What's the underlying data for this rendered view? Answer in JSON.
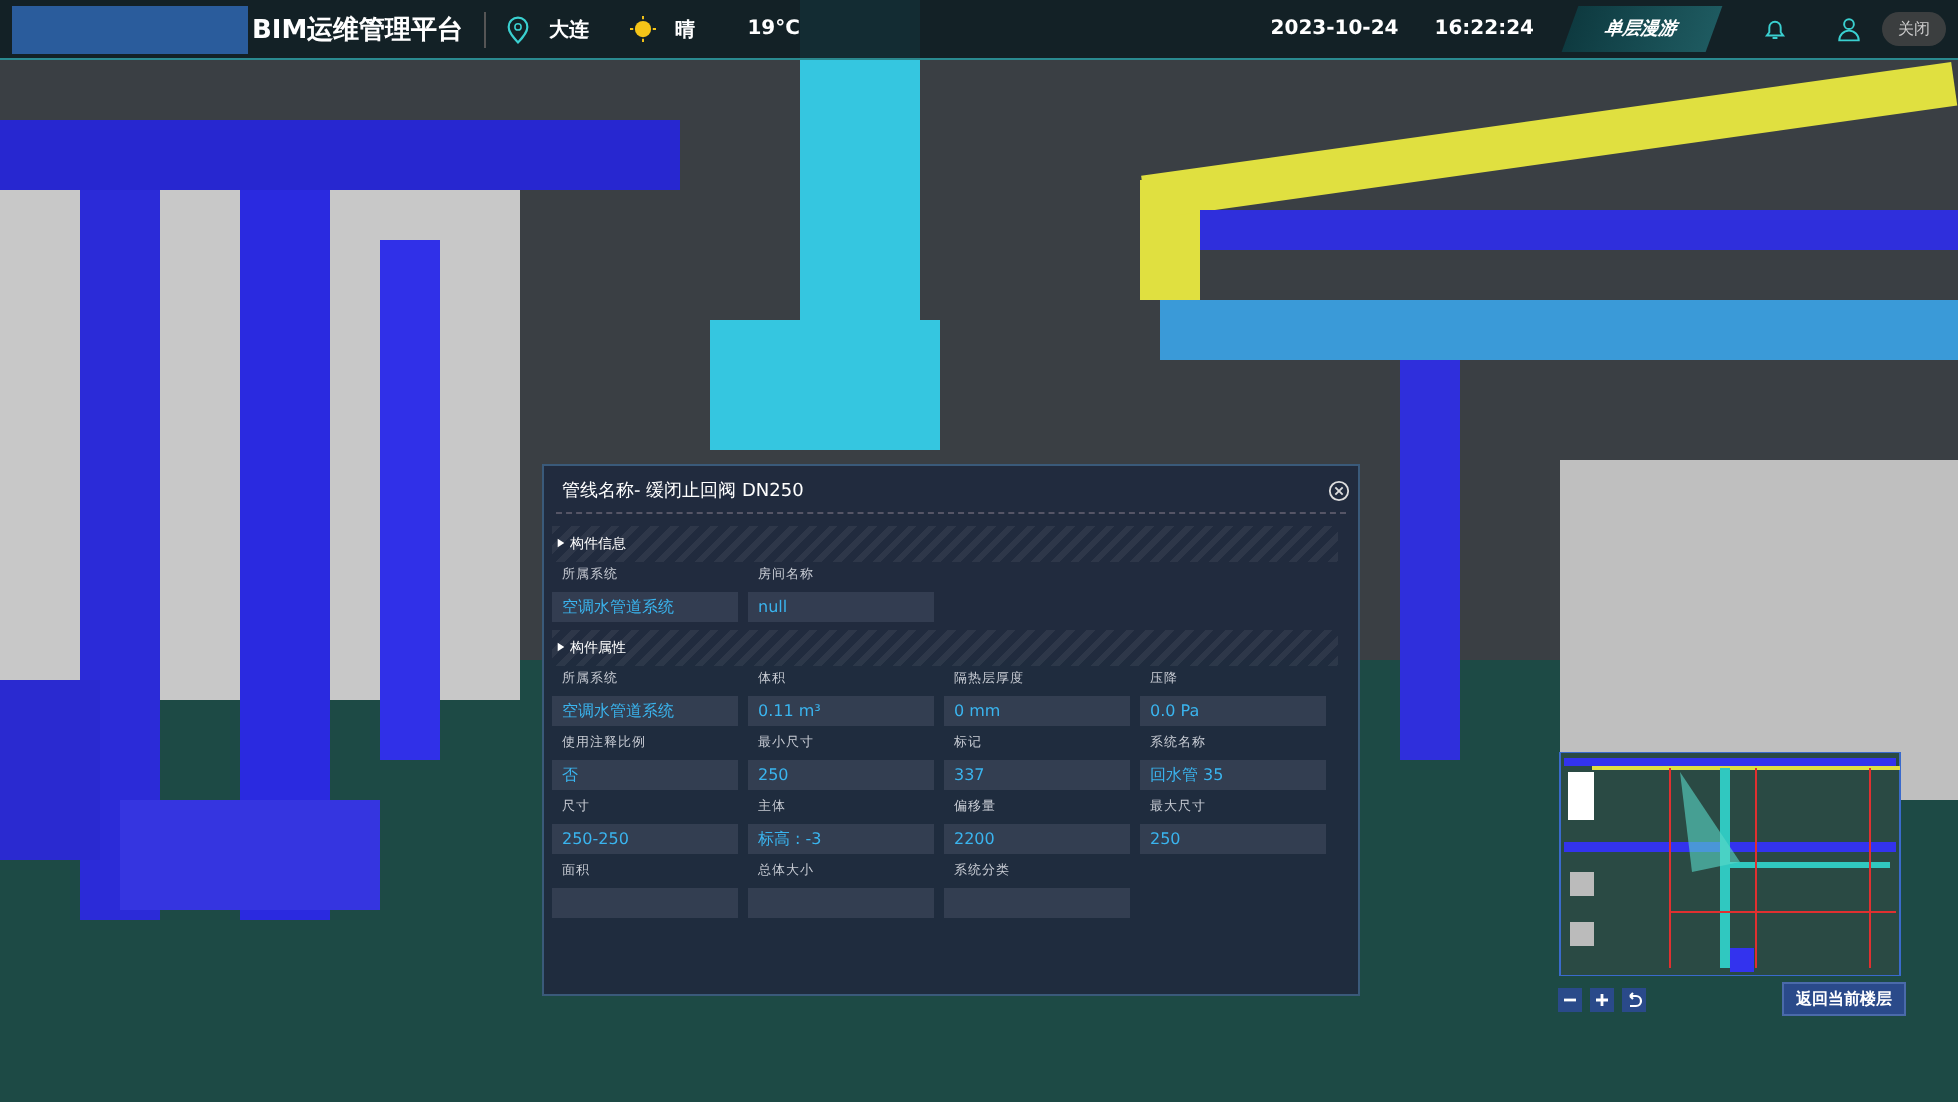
{
  "header": {
    "title": "BIM运维管理平台",
    "city": "大连",
    "weather": "晴",
    "temperature": "19°C",
    "date": "2023-10-24",
    "time": "16:22:24",
    "mode_button": "单层漫游",
    "close": "关闭"
  },
  "panel": {
    "title": "管线名称-  缓闭止回阀 DN250",
    "sections": [
      {
        "title": "构件信息",
        "fields": [
          {
            "label": "所属系统",
            "value": "空调水管道系统"
          },
          {
            "label": "房间名称",
            "value": "null"
          }
        ]
      },
      {
        "title": "构件属性",
        "fields": [
          {
            "label": "所属系统",
            "value": "空调水管道系统"
          },
          {
            "label": "体积",
            "value": "0.11 m³"
          },
          {
            "label": "隔热层厚度",
            "value": "0 mm"
          },
          {
            "label": "压降",
            "value": "0.0 Pa"
          },
          {
            "label": "使用注释比例",
            "value": "否"
          },
          {
            "label": "最小尺寸",
            "value": "250"
          },
          {
            "label": "标记",
            "value": "337"
          },
          {
            "label": "系统名称",
            "value": "回水管 35"
          },
          {
            "label": "尺寸",
            "value": "250-250"
          },
          {
            "label": "主体",
            "value": "标高 : -3"
          },
          {
            "label": "偏移量",
            "value": "2200"
          },
          {
            "label": "最大尺寸",
            "value": "250"
          },
          {
            "label": "面积"
          },
          {
            "label": "总体大小"
          },
          {
            "label": "系统分类"
          }
        ]
      }
    ]
  },
  "minimap": {
    "back_button": "返回当前楼层"
  }
}
